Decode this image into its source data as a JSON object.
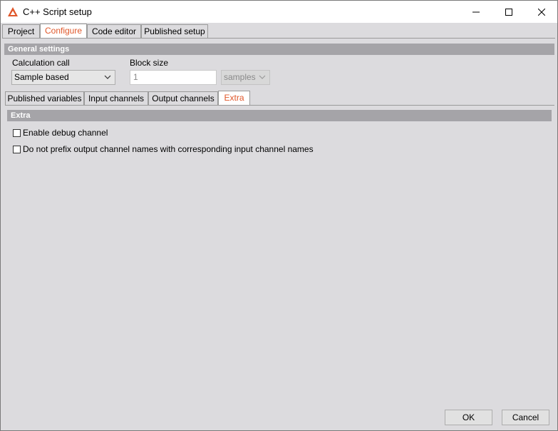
{
  "window": {
    "title": "C++ Script setup",
    "controls": {
      "minimize": "minimize",
      "maximize": "maximize",
      "close": "close"
    }
  },
  "main_tabs": [
    {
      "label": "Project"
    },
    {
      "label": "Configure",
      "active": true
    },
    {
      "label": "Code editor"
    },
    {
      "label": "Published setup"
    }
  ],
  "general_settings": {
    "header": "General settings",
    "calculation_call": {
      "label": "Calculation call",
      "value": "Sample based"
    },
    "block_size": {
      "label": "Block size",
      "value": "1",
      "unit": "samples"
    }
  },
  "sub_tabs": [
    {
      "label": "Published variables"
    },
    {
      "label": "Input channels"
    },
    {
      "label": "Output channels"
    },
    {
      "label": "Extra",
      "active": true
    }
  ],
  "extra": {
    "header": "Extra",
    "options": [
      {
        "label": "Enable debug channel",
        "checked": false
      },
      {
        "label": "Do not prefix output channel names with corresponding input channel names",
        "checked": false
      }
    ]
  },
  "footer": {
    "ok": "OK",
    "cancel": "Cancel"
  },
  "colors": {
    "accent": "#e0572a",
    "section_header": "#a5a4a8",
    "panel": "#dcdbde"
  }
}
